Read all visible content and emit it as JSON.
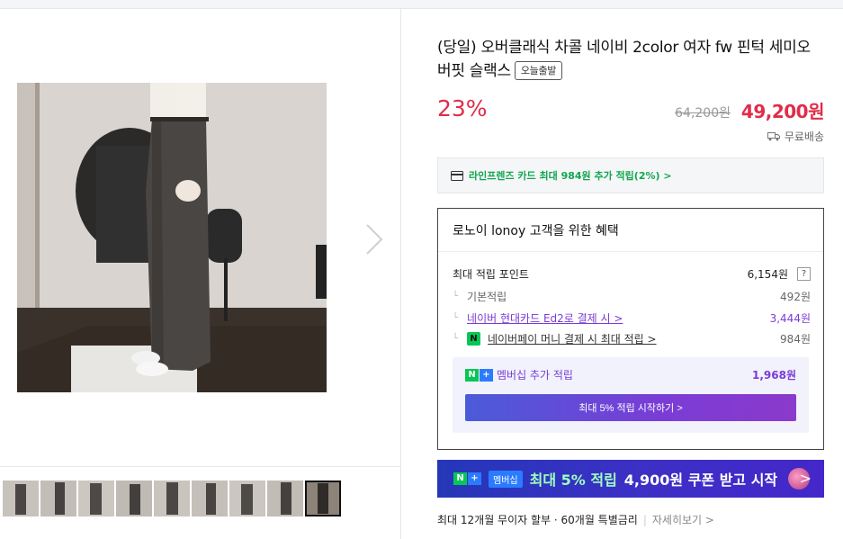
{
  "product": {
    "title": "(당일) 오버클래식 차콜 네이비 2color 여자 fw 핀턱 세미오버핏 슬랙스",
    "badge": "오늘출발",
    "discount": "23%",
    "original_price": "64,200원",
    "price": "49,200원",
    "shipping": "무료배송"
  },
  "card_promo": "라인프렌즈 카드 최대 984원 추가 적립(2%) >",
  "benefit": {
    "title": "로노이 lonoy 고객을 위한 혜택",
    "max_points_label": "최대 적립 포인트",
    "max_points_value": "6,154원",
    "help": "?",
    "rows": [
      {
        "label": "기본적립",
        "value": "492원"
      },
      {
        "label": "네이버 현대카드 Ed2로 결제 시 >",
        "value": "3,444원"
      },
      {
        "label": "네이버페이 머니 결제 시 최대 적립 >",
        "value": "984원"
      }
    ],
    "membership_label": "멤버십 추가 적립",
    "membership_value": "1,968원",
    "membership_button": "최대 5% 적립 시작하기 >"
  },
  "banner": {
    "tag": "멤버십",
    "highlight": "최대 5% 적립",
    "rest": "4,900원 쿠폰 받고 시작",
    "chevron": ">"
  },
  "installment": {
    "text": "최대 12개월 무이자 할부 · 60개월 특별금리",
    "more": "자세히보기 >"
  },
  "icons": [
    "chevron-right-icon",
    "truck-icon",
    "card-icon",
    "naver-pay-icon",
    "naver-plus-icon"
  ],
  "colors": {
    "price_red": "#e02d4a",
    "naver_green": "#06c755",
    "purple": "#7a3cd6"
  }
}
